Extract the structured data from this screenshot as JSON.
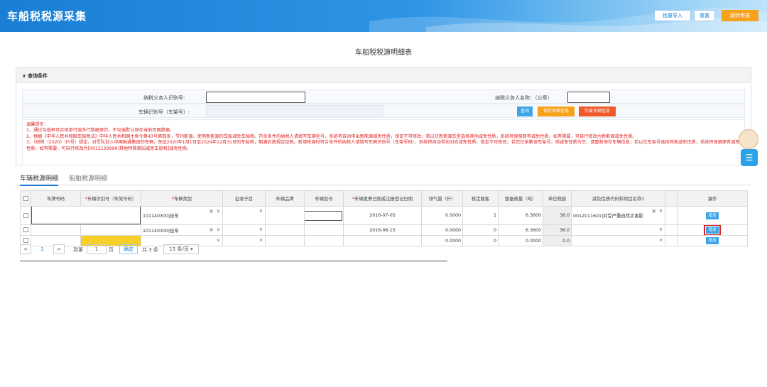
{
  "header": {
    "title": "车船税税源采集",
    "batch_import": "批量导入",
    "reset": "重置",
    "jump_declare": "跳转申报"
  },
  "page_title": "车船税税源明细表",
  "query": {
    "section_label": "查询条件",
    "taxpayer_id_label": "纳税义务人识别号:",
    "taxpayer_name_label": "纳税义务人名称：（公章）",
    "vin_label": "车辆识别号（车架号）:",
    "query_btn": "查询",
    "save_vehicle_btn": "保存车辆信息",
    "void_vehicle_btn": "作废车辆信息"
  },
  "tips": {
    "heading": "温馨提示：",
    "line1": "1、通过勾选框可实现单行或多行数据保存，不勾选默认保存当前页面数据。",
    "line2": "2、根据《中华人民共和国车船税法》中华人民共和国主席令第43号第四条，节约能源、使用新能源的车船减免车船税。符合条件的纳税人请填写车辆型号，系统将自动带出新能源减免性质，锁定不可修改；若以往新能源车型选择其他减免性质，系统将保留原有减免性质，如有需要，可自行修改为新能源减免性质。",
    "line3": "3、（财税〔2020〕35号）规定，对军队划入中国融通集团的车辆，免征2020年1月1日至2024年12月31日的车船税，期满后按规定征税。新增税源时符合条件的纳税人请填写车辆识别号（车架号码），系统将自动带出对应减免性质，锁定不可修改；若您已采集该车架号，但减免性质为空，请重新保存车辆信息；若以往车架号选择其他减免性质，系统将保留原有减免性质，如有需要，可自行修改为[0012129999]其他特殊原因减免车船税]减免性质。"
  },
  "tabs": [
    "车辆税源明细",
    "船舶税源明细"
  ],
  "table": {
    "headers": [
      "车牌号码",
      "车辆识别号（车架号码）",
      "车辆类型",
      "征收子目",
      "车辆品牌",
      "车辆型号",
      "车辆发票日期或注册登记日期",
      "排气量（升）",
      "核定载客",
      "整备质量（吨）",
      "单位税额",
      "减免性质代码和项目名称1",
      "",
      "操作"
    ],
    "required": [
      "车辆识别号（车架号码）",
      "车辆类型",
      "车辆发票日期或注册登记日期"
    ],
    "rows": [
      {
        "vehicle_type": "101140300|挂车",
        "date": "2016-07-05",
        "displacement": "0.0000",
        "seats": "1",
        "curb_weight": "6.3600",
        "unit_tax": "36.0",
        "exemption": "0012011601|对受严重自然灾害影",
        "action": "增加"
      },
      {
        "vehicle_type": "101140300|挂车",
        "date": "2016-06-15",
        "displacement": "0.0000",
        "seats": "0",
        "curb_weight": "6.3600",
        "unit_tax": "36.0",
        "exemption": "",
        "action": "增加"
      },
      {
        "vehicle_type": "",
        "date": "",
        "displacement": "0.0000",
        "seats": "0",
        "curb_weight": "0.0000",
        "unit_tax": "0.0",
        "exemption": "",
        "action": "增加"
      }
    ]
  },
  "pager": {
    "prev": "<",
    "current": "1",
    "next": ">",
    "goto_label": "到第",
    "page_value": "1",
    "page_unit": "页",
    "confirm": "确定",
    "total": "共 3 条",
    "page_size": "15 条/页"
  }
}
